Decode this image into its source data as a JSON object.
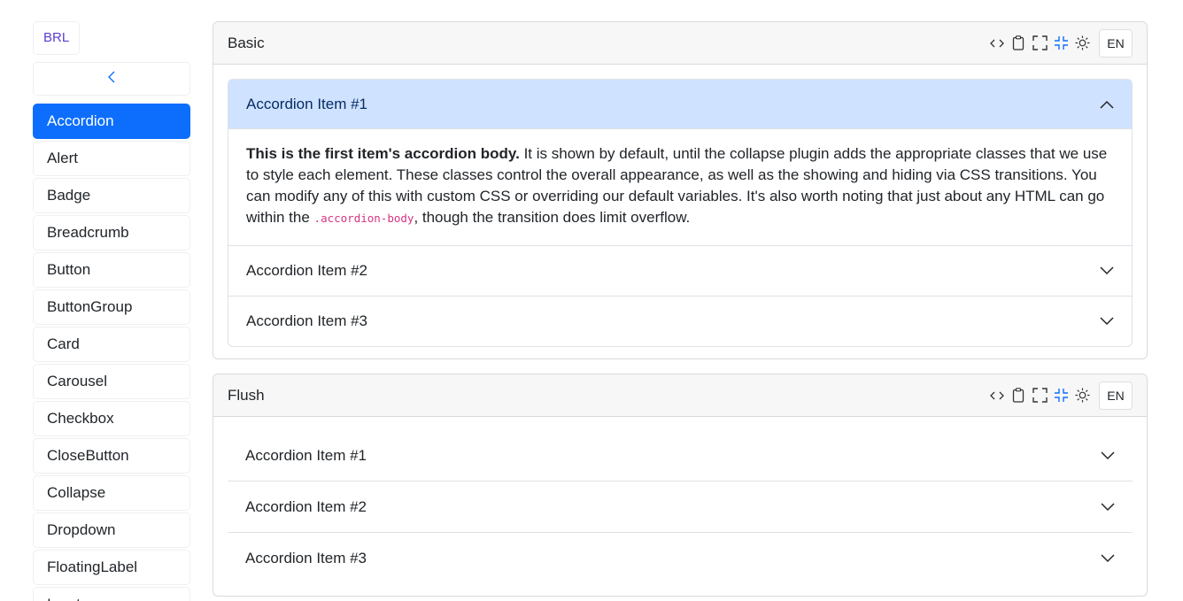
{
  "brand": "BRL",
  "sidebar": {
    "items": [
      {
        "label": "Accordion",
        "active": true
      },
      {
        "label": "Alert"
      },
      {
        "label": "Badge"
      },
      {
        "label": "Breadcrumb"
      },
      {
        "label": "Button"
      },
      {
        "label": "ButtonGroup"
      },
      {
        "label": "Card"
      },
      {
        "label": "Carousel"
      },
      {
        "label": "Checkbox"
      },
      {
        "label": "CloseButton"
      },
      {
        "label": "Collapse"
      },
      {
        "label": "Dropdown"
      },
      {
        "label": "FloatingLabel"
      },
      {
        "label": "Input"
      }
    ]
  },
  "cards": {
    "basic": {
      "title": "Basic",
      "lang": "EN",
      "items": [
        {
          "label": "Accordion Item #1"
        },
        {
          "label": "Accordion Item #2"
        },
        {
          "label": "Accordion Item #3"
        }
      ],
      "body": {
        "strong": "This is the first item's accordion body.",
        "text1": " It is shown by default, until the collapse plugin adds the appropriate classes that we use to style each element. These classes control the overall appearance, as well as the showing and hiding via CSS transitions. You can modify any of this with custom CSS or overriding our default variables. It's also worth noting that just about any HTML can go within the ",
        "code": ".accordion-body",
        "text2": ", though the transition does limit overflow."
      }
    },
    "flush": {
      "title": "Flush",
      "lang": "EN",
      "items": [
        {
          "label": "Accordion Item #1"
        },
        {
          "label": "Accordion Item #2"
        },
        {
          "label": "Accordion Item #3"
        }
      ]
    }
  },
  "icons": {
    "toolbar": [
      "code-icon",
      "clipboard-icon",
      "fullscreen-icon",
      "compress-icon",
      "sun-icon"
    ],
    "accent": "#0d6efd",
    "active_header_bg": "#cfe2ff"
  }
}
